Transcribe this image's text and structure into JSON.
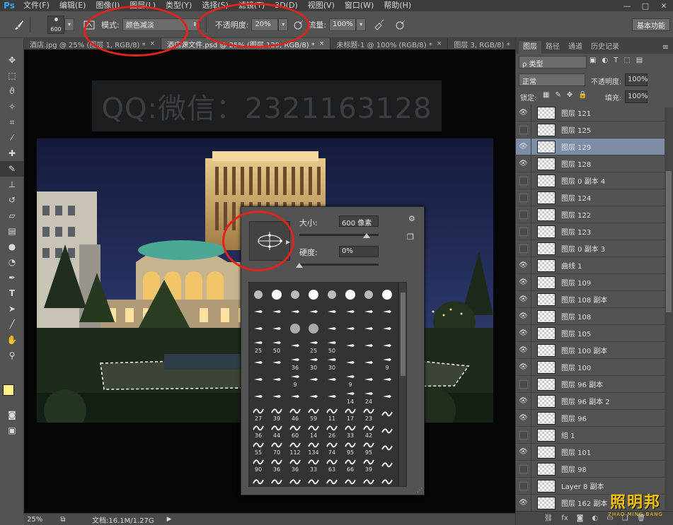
{
  "app": {
    "logo": "Ps"
  },
  "menu": [
    "文件(F)",
    "编辑(E)",
    "图像(I)",
    "图层(L)",
    "类型(Y)",
    "选择(S)",
    "滤镜(T)",
    "3D(D)",
    "视图(V)",
    "窗口(W)",
    "帮助(H)"
  ],
  "window_controls": {
    "minimize": "—",
    "maximize": "□",
    "close": "✕"
  },
  "options": {
    "brush_size": "600",
    "mode_label": "模式:",
    "mode_value": "颜色减淡",
    "opacity_label": "不透明度:",
    "opacity_value": "20%",
    "flow_label": "流量:",
    "flow_value": "100%",
    "workspace": "基本功能"
  },
  "tabs": [
    {
      "label": "酒店.jpg @ 25% (图层 1, RGB/8) *",
      "active": false
    },
    {
      "label": "酒店源文件.psd @ 25% (图层 129, RGB/8) *",
      "active": true
    },
    {
      "label": "未标题-1 @ 100% (RGB/8) *",
      "active": false
    },
    {
      "label": "图层 3, RGB/8) *",
      "active": false
    }
  ],
  "canvas": {
    "watermark": "QQ:微信：2321163128"
  },
  "status": {
    "zoom": "25%",
    "doc": "文档:16.1M/1.27G"
  },
  "brush_panel": {
    "size_label": "大小:",
    "size_value": "600 像素",
    "hardness_label": "硬度:",
    "hardness_value": "0%",
    "size_level": 0.85,
    "hardness_level": 0.0,
    "rows": [
      [
        "",
        "",
        "",
        "",
        "",
        "",
        "",
        ""
      ],
      [
        "",
        "",
        "",
        "",
        "",
        "",
        "",
        ""
      ],
      [
        "",
        "",
        "",
        "",
        "",
        "",
        "",
        ""
      ],
      [
        "25",
        "50",
        "",
        "25",
        "50",
        "",
        "",
        ""
      ],
      [
        "",
        "",
        "36",
        "30",
        "30",
        "",
        "",
        "9"
      ],
      [
        "",
        "",
        "9",
        "",
        "",
        "9",
        "",
        ""
      ],
      [
        "",
        "",
        "",
        "",
        "",
        "14",
        "24",
        ""
      ],
      [
        "27",
        "39",
        "46",
        "59",
        "11",
        "17",
        "23",
        ""
      ],
      [
        "36",
        "44",
        "60",
        "14",
        "26",
        "33",
        "42",
        ""
      ],
      [
        "55",
        "70",
        "112",
        "134",
        "74",
        "95",
        "95",
        ""
      ],
      [
        "90",
        "36",
        "36",
        "33",
        "63",
        "66",
        "39",
        ""
      ],
      [
        "",
        "",
        "",
        "",
        "",
        "",
        "",
        ""
      ]
    ]
  },
  "panel": {
    "tabs": [
      "图层",
      "路径",
      "通道",
      "历史记录"
    ],
    "filter_label": "ρ 类型",
    "blend_mode": "正常",
    "opacity_label": "不透明度:",
    "opacity_value": "100%",
    "lock_label": "锁定:",
    "fill_label": "填充:",
    "fill_value": "100%",
    "footer": [
      "⛓",
      "fx",
      "◙",
      "◐",
      "▭",
      "❏",
      "🗑"
    ]
  },
  "layers": [
    {
      "name": "图层 121",
      "visible": true,
      "selected": false
    },
    {
      "name": "图层 125",
      "visible": false,
      "selected": false
    },
    {
      "name": "图层 129",
      "visible": true,
      "selected": true
    },
    {
      "name": "图层 128",
      "visible": true,
      "selected": false
    },
    {
      "name": "图层 0 副本 4",
      "visible": false,
      "selected": false
    },
    {
      "name": "图层 124",
      "visible": false,
      "selected": false
    },
    {
      "name": "图层 122",
      "visible": false,
      "selected": false
    },
    {
      "name": "图层 123",
      "visible": false,
      "selected": false
    },
    {
      "name": "图层 0 副本 3",
      "visible": false,
      "selected": false
    },
    {
      "name": "曲线 1",
      "visible": true,
      "selected": false
    },
    {
      "name": "图层 109",
      "visible": true,
      "selected": false
    },
    {
      "name": "图层 108 副本",
      "visible": true,
      "selected": false
    },
    {
      "name": "图层 108",
      "visible": true,
      "selected": false
    },
    {
      "name": "图层 105",
      "visible": true,
      "selected": false
    },
    {
      "name": "图层 100 副本",
      "visible": true,
      "selected": false
    },
    {
      "name": "图层 100",
      "visible": true,
      "selected": false
    },
    {
      "name": "图层 96 副本",
      "visible": false,
      "selected": false
    },
    {
      "name": "图层 96 副本 2",
      "visible": true,
      "selected": false
    },
    {
      "name": "图层 96",
      "visible": true,
      "selected": false
    },
    {
      "name": "组 1",
      "visible": false,
      "selected": false
    },
    {
      "name": "图层 101",
      "visible": true,
      "selected": false
    },
    {
      "name": "图层 98",
      "visible": false,
      "selected": false
    },
    {
      "name": "Layer 8 副本",
      "visible": false,
      "selected": false
    },
    {
      "name": "图层 162 副本",
      "visible": true,
      "selected": false
    }
  ],
  "brand": {
    "cn": "照明邦",
    "en": "ZHAO MING BANG"
  }
}
